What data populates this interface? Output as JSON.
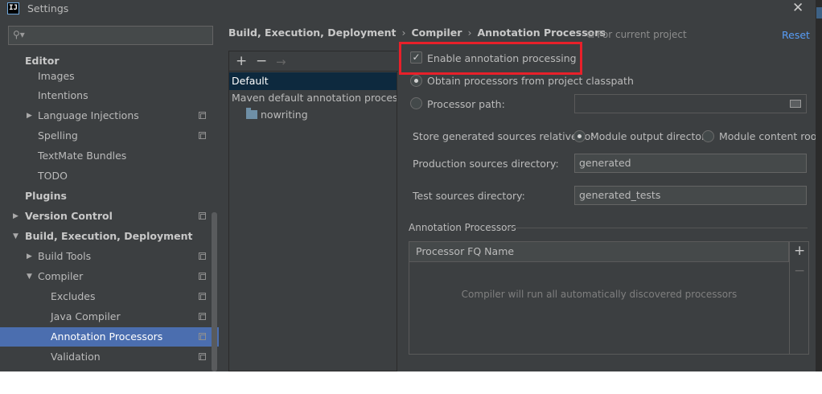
{
  "window": {
    "title": "Settings",
    "app_icon_text": "IJ"
  },
  "search": {
    "placeholder": "",
    "value": "",
    "icon": "search-icon"
  },
  "sidebar": {
    "items": [
      {
        "label": "Editor"
      },
      {
        "label": "Images"
      },
      {
        "label": "Intentions"
      },
      {
        "label": "Language Injections"
      },
      {
        "label": "Spelling"
      },
      {
        "label": "TextMate Bundles"
      },
      {
        "label": "TODO"
      },
      {
        "label": "Plugins"
      },
      {
        "label": "Version Control"
      },
      {
        "label": "Build, Execution, Deployment"
      },
      {
        "label": "Build Tools"
      },
      {
        "label": "Compiler"
      },
      {
        "label": "Excludes"
      },
      {
        "label": "Java Compiler"
      },
      {
        "label": "Annotation Processors",
        "selected": true
      },
      {
        "label": "Validation"
      }
    ]
  },
  "breadcrumb": {
    "items": [
      "Build, Execution, Deployment",
      "Compiler",
      "Annotation Processors"
    ],
    "separator": "›"
  },
  "scope": {
    "icon": "copy-icon",
    "label": "For current project"
  },
  "reset_label": "Reset",
  "profiles": {
    "toolbar": {
      "add": "+",
      "remove": "−",
      "move": "→"
    },
    "rows": [
      {
        "label": "Default",
        "selected": true
      },
      {
        "label": "Maven default annotation processors p"
      },
      {
        "label": "nowriting"
      }
    ]
  },
  "settings": {
    "enable_label": "Enable annotation processing",
    "enable_checked": true,
    "obtain_label": "Obtain processors from project classpath",
    "processor_path_label": "Processor path:",
    "processor_path_value": "",
    "store_label": "Store generated sources relative to:",
    "module_output_label": "Module output directory",
    "module_content_label": "Module content root",
    "production_label": "Production sources directory:",
    "production_value": "generated",
    "test_label": "Test sources directory:",
    "test_value": "generated_tests"
  },
  "annotation_processors": {
    "section_title": "Annotation Processors",
    "column_header": "Processor FQ Name",
    "empty_text": "Compiler will run all automatically discovered processors",
    "add": "+",
    "remove": "−"
  },
  "colors": {
    "background": "#3c3f41",
    "selection": "#4b6eaf",
    "link": "#589df6",
    "highlight_box": "#e8202a"
  }
}
